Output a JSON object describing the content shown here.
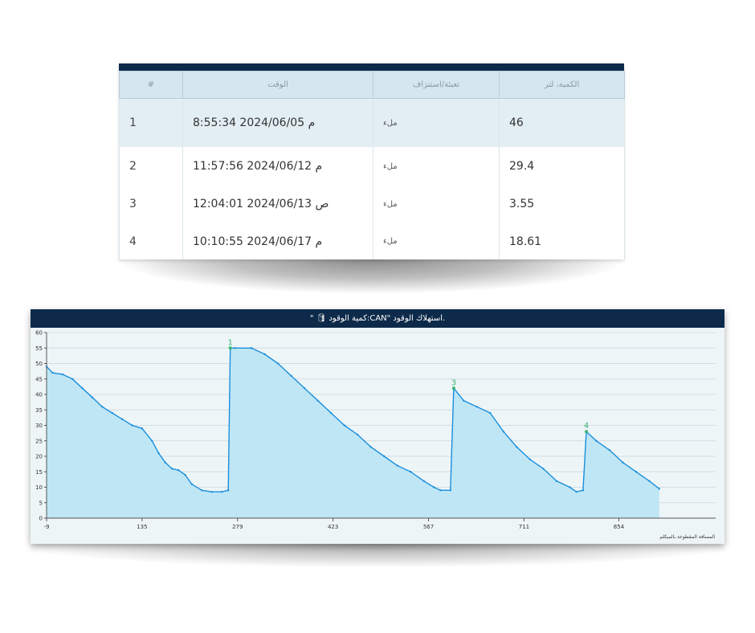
{
  "table": {
    "headers": [
      "الكمية، لتر",
      "تعبئة/استنزاف",
      "الوقت",
      "#"
    ],
    "rows": [
      {
        "num": "1",
        "time": "8:55:34 2024/06/05 م",
        "type": "ملء",
        "qty": "46"
      },
      {
        "num": "2",
        "time": "11:57:56 2024/06/12 م",
        "type": "ملء",
        "qty": "29.4"
      },
      {
        "num": "3",
        "time": "12:04:01 2024/06/13 ص",
        "type": "ملء",
        "qty": "3.55"
      },
      {
        "num": "4",
        "time": "10:10:55 2024/06/17 م",
        "type": "ملء",
        "qty": "18.61"
      }
    ]
  },
  "chart": {
    "title": "\" 🛢 كمية الوقود:CAN\" استهلاك الوقود.",
    "line_color": "#1a8fdc",
    "fill_color": "#bfe6f5",
    "marker_color": "#3cb371",
    "grid_color": "#d2dee3"
  },
  "chart_data": {
    "type": "area",
    "title": "\" 🛢 كمية الوقود:CAN\" استهلاك الوقود.",
    "xlabel": "المسافة المقطوعة بالميكلم",
    "ylabel": "",
    "xlim": [
      -9,
      1000
    ],
    "ylim": [
      0,
      60
    ],
    "xticks": [
      -9,
      135,
      279,
      423,
      567,
      711,
      854
    ],
    "yticks": [
      0,
      5,
      10,
      15,
      20,
      25,
      30,
      35,
      40,
      45,
      50,
      55,
      60
    ],
    "grid": true,
    "series": [
      {
        "x": [
          -9,
          0,
          15,
          30,
          45,
          60,
          75,
          90,
          105,
          120,
          135,
          150,
          160,
          170,
          180,
          190,
          200,
          210,
          225,
          240,
          255,
          265,
          268,
          275,
          300,
          320,
          340,
          360,
          380,
          400,
          420,
          440,
          460,
          480,
          500,
          520,
          540,
          560,
          575,
          585,
          600,
          605,
          620,
          640,
          660,
          680,
          700,
          720,
          740,
          760,
          780,
          790,
          800,
          805,
          820,
          840,
          860,
          880,
          900,
          915
        ],
        "y": [
          49,
          47,
          46.5,
          45,
          42,
          39,
          36,
          34,
          32,
          30,
          29,
          25,
          21,
          18,
          16,
          15.5,
          14,
          11,
          9,
          8.5,
          8.5,
          9,
          55,
          55,
          55,
          53,
          50,
          46,
          42,
          38,
          34,
          30,
          27,
          23,
          20,
          17,
          15,
          12,
          10,
          9,
          9,
          42,
          38,
          36,
          34,
          28,
          23,
          19,
          16,
          12,
          10,
          8.5,
          9,
          28,
          25,
          22,
          18,
          15,
          12,
          9.5
        ]
      }
    ],
    "annotations": [
      {
        "label": "1",
        "x": 268,
        "y": 55
      },
      {
        "label": "3",
        "x": 605,
        "y": 42
      },
      {
        "label": "4",
        "x": 805,
        "y": 28
      }
    ]
  }
}
